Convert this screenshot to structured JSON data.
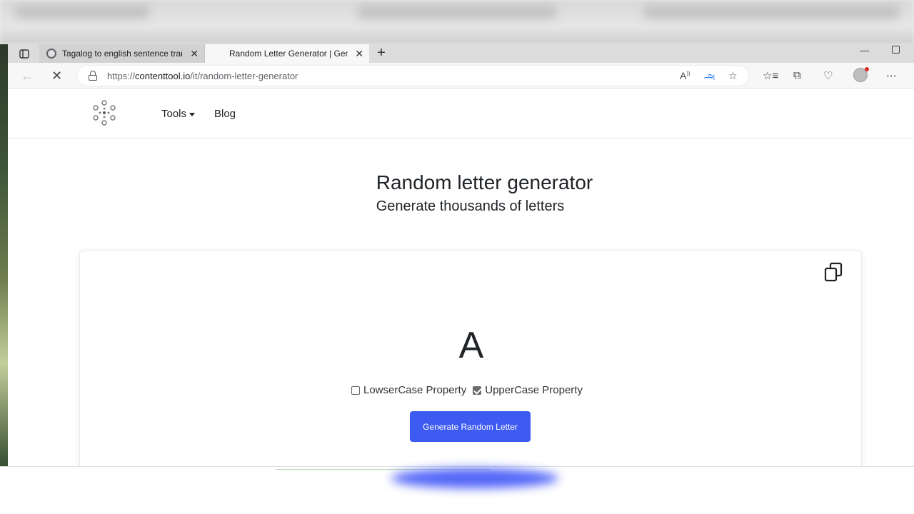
{
  "browser": {
    "tabs": [
      {
        "title": "Tagalog to english sentence tran",
        "active": false
      },
      {
        "title": "Random Letter Generator | Gene",
        "active": true
      }
    ],
    "new_tab_label": "+",
    "close_label": "✕",
    "url_prefix": "https://",
    "url_host": "contenttool.io",
    "url_path": "/it/random-letter-generator",
    "minimize_label": "—"
  },
  "site": {
    "nav": {
      "tools_label": "Tools",
      "blog_label": "Blog"
    }
  },
  "hero": {
    "title": "Random letter generator",
    "subtitle": "Generate thousands of letters"
  },
  "generator": {
    "current_letter": "A",
    "options": [
      {
        "label": "LowserCase Property",
        "checked": false
      },
      {
        "label": "UpperCase Property",
        "checked": true
      }
    ],
    "generate_button_label": "Generate Random Letter",
    "accent_color": "#3d5af1"
  }
}
